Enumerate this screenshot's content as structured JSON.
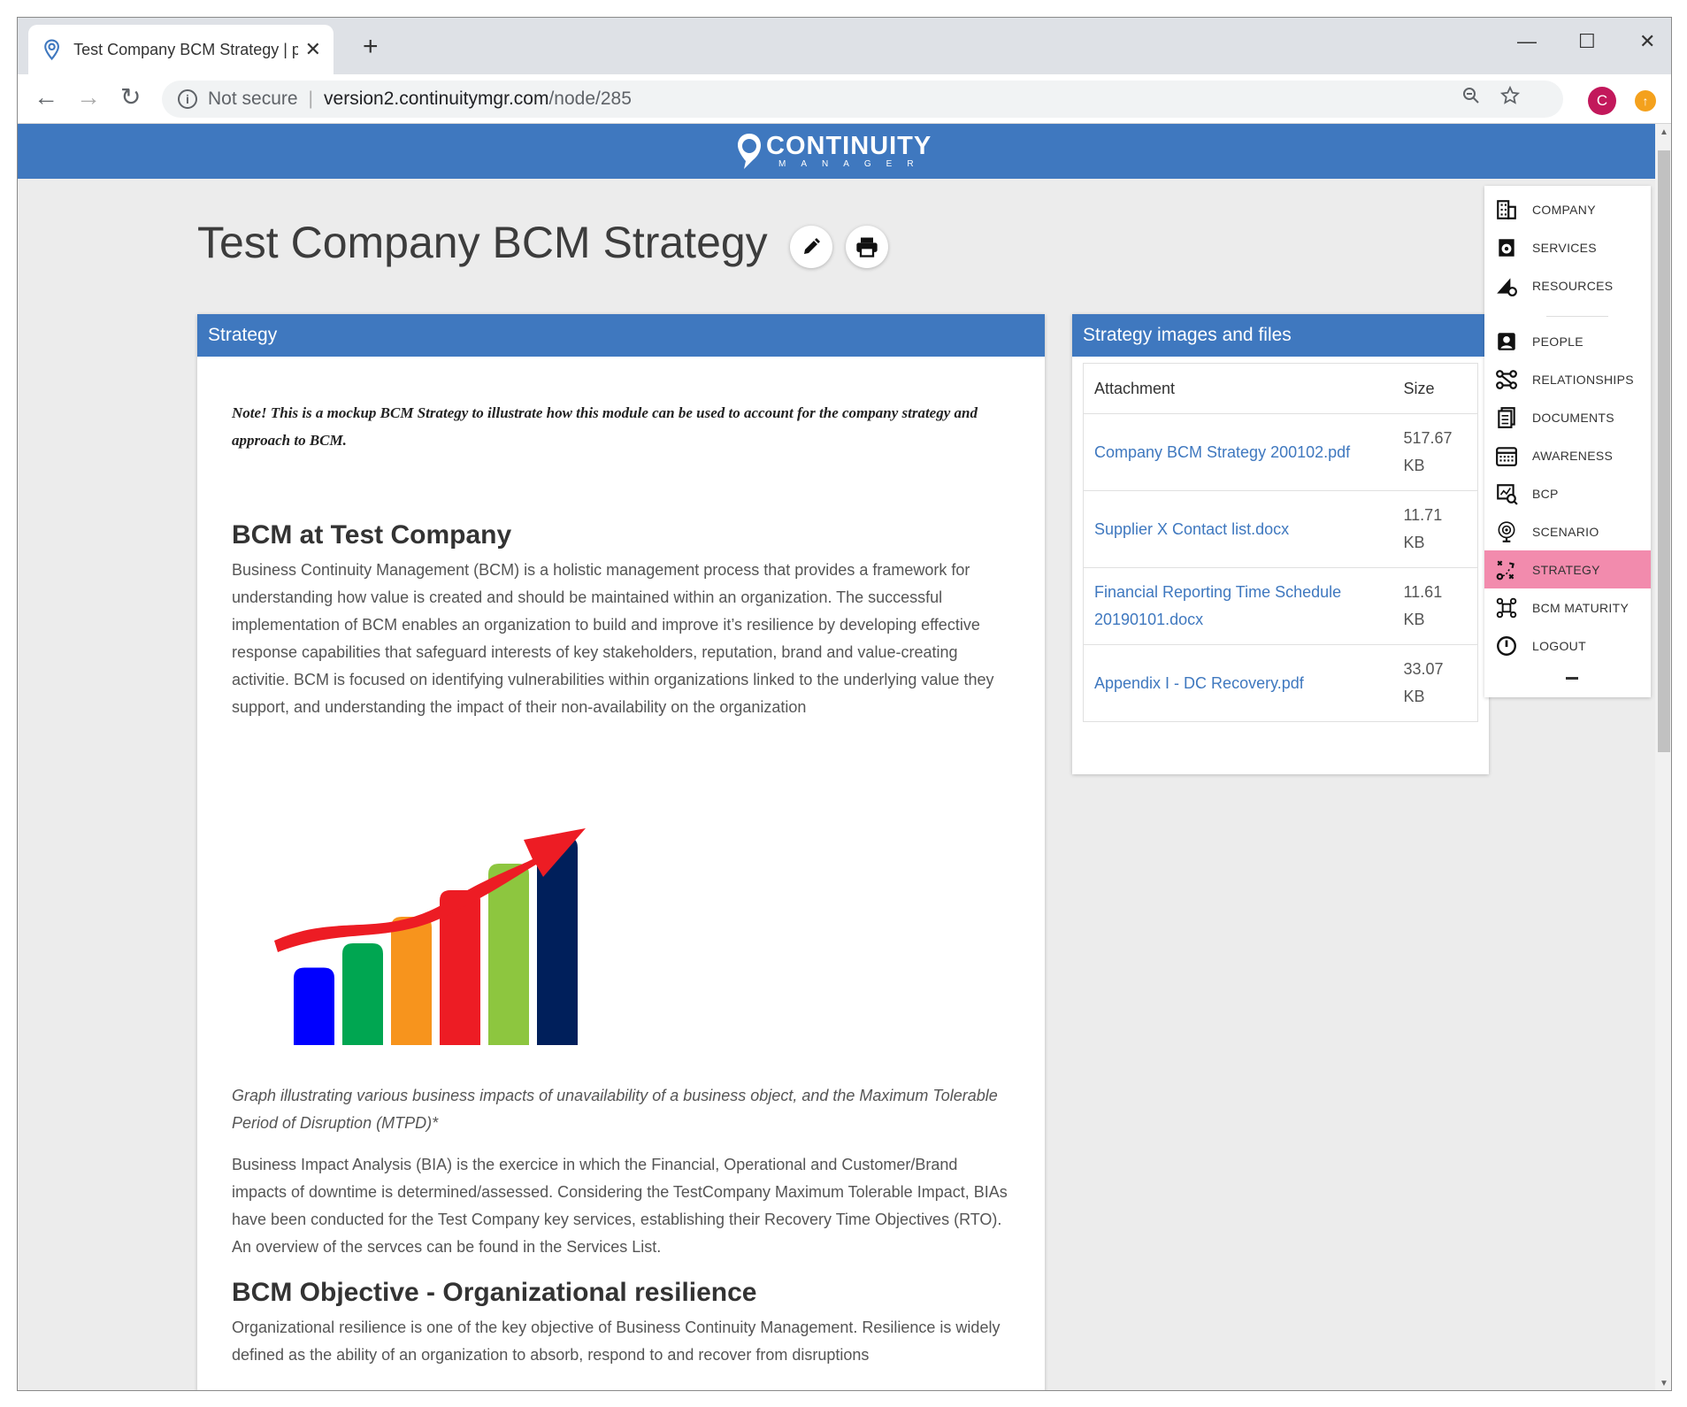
{
  "browser": {
    "tab_title": "Test Company BCM Strategy | personal",
    "tab_close": "✕",
    "new_tab": "+",
    "not_secure": "Not secure",
    "url_host": "version2.continuitymgr.com",
    "url_path": "/node/285",
    "avatar_letter": "C",
    "controls": {
      "minimize": "—",
      "maximize": "☐",
      "close": "✕"
    }
  },
  "logo": {
    "word": "CONTINUITY",
    "sub": "MANAGER"
  },
  "page": {
    "title": "Test Company BCM Strategy",
    "edit_icon": "pencil-icon",
    "print_icon": "printer-icon"
  },
  "strategy": {
    "header": "Strategy",
    "note": "Note! This is a mockup BCM Strategy to illustrate how this module can be used to account for the company strategy and approach to BCM.",
    "section1_title": "BCM at Test Company",
    "section1_text": "Business Continuity Management (BCM) is a holistic management process that provides a framework for understanding  how value is created and should be maintained within an organization. The successful implementation of BCM enables an organization to build and improve it’s resilience by developing effective response capabilities that safeguard interests of key stakeholders, reputation, brand and value-creating activitie. BCM is focused on identifying vulnerabilities within organizations linked to the underlying value they support, and understanding the impact of their non-availability on the organization",
    "caption": "Graph illustrating various business impacts of unavailability of a business object, and the Maximum Tolerable Period of Disruption (MTPD)*",
    "section1_text2": "Business Impact Analysis (BIA) is the exercice in which the Financial, Operational and Customer/Brand impacts of downtime is determined/assessed. Considering the TestCompany Maximum Tolerable Impact, BIAs have been conducted for the Test Company key services, establishing their Recovery Time Objectives (RTO). An overview of the servces can be found in the Services List.",
    "section2_title": "BCM Objective - Organizational resilience",
    "section2_text": "Organizational resilience is one of the key objective of Business Continuity Management. Resilience is widely defined as the ability of an organization to absorb, respond to and recover from disruptions",
    "image_bars": [
      {
        "color": "#0000ff",
        "level": 0.35
      },
      {
        "color": "#00a651",
        "level": 0.46
      },
      {
        "color": "#f7941d",
        "level": 0.58
      },
      {
        "color": "#ed1c24",
        "level": 0.7
      },
      {
        "color": "#8dc63f",
        "level": 0.82
      },
      {
        "color": "#001f5b",
        "level": 0.94
      }
    ],
    "arrow_color": "#ed1c24"
  },
  "files": {
    "header": "Strategy images and files",
    "columns": [
      "Attachment",
      "Size"
    ],
    "rows": [
      {
        "name": "Company BCM Strategy 200102.pdf",
        "size": "517.67 KB"
      },
      {
        "name": "Supplier X Contact list.docx",
        "size": "11.71 KB"
      },
      {
        "name": "Financial Reporting Time Schedule 20190101.docx",
        "size": "11.61 KB"
      },
      {
        "name": "Appendix I - DC Recovery.pdf",
        "size": "33.07 KB"
      }
    ]
  },
  "nav": {
    "items": [
      {
        "label": "COMPANY",
        "icon": "building-icon"
      },
      {
        "label": "SERVICES",
        "icon": "services-icon"
      },
      {
        "label": "RESOURCES",
        "icon": "resources-icon"
      },
      {
        "label": "PEOPLE",
        "icon": "person-icon"
      },
      {
        "label": "RELATIONSHIPS",
        "icon": "relationships-icon"
      },
      {
        "label": "DOCUMENTS",
        "icon": "documents-icon"
      },
      {
        "label": "AWARENESS",
        "icon": "calendar-icon"
      },
      {
        "label": "BCP",
        "icon": "bcp-icon"
      },
      {
        "label": "SCENARIO",
        "icon": "scenario-icon"
      },
      {
        "label": "STRATEGY",
        "icon": "strategy-icon",
        "active": true
      },
      {
        "label": "BCM MATURITY",
        "icon": "maturity-icon"
      },
      {
        "label": "LOGOUT",
        "icon": "power-icon"
      }
    ]
  },
  "colors": {
    "brand_blue": "#3f78bf",
    "active_nav": "#f28bad",
    "link": "#3f78bf"
  }
}
